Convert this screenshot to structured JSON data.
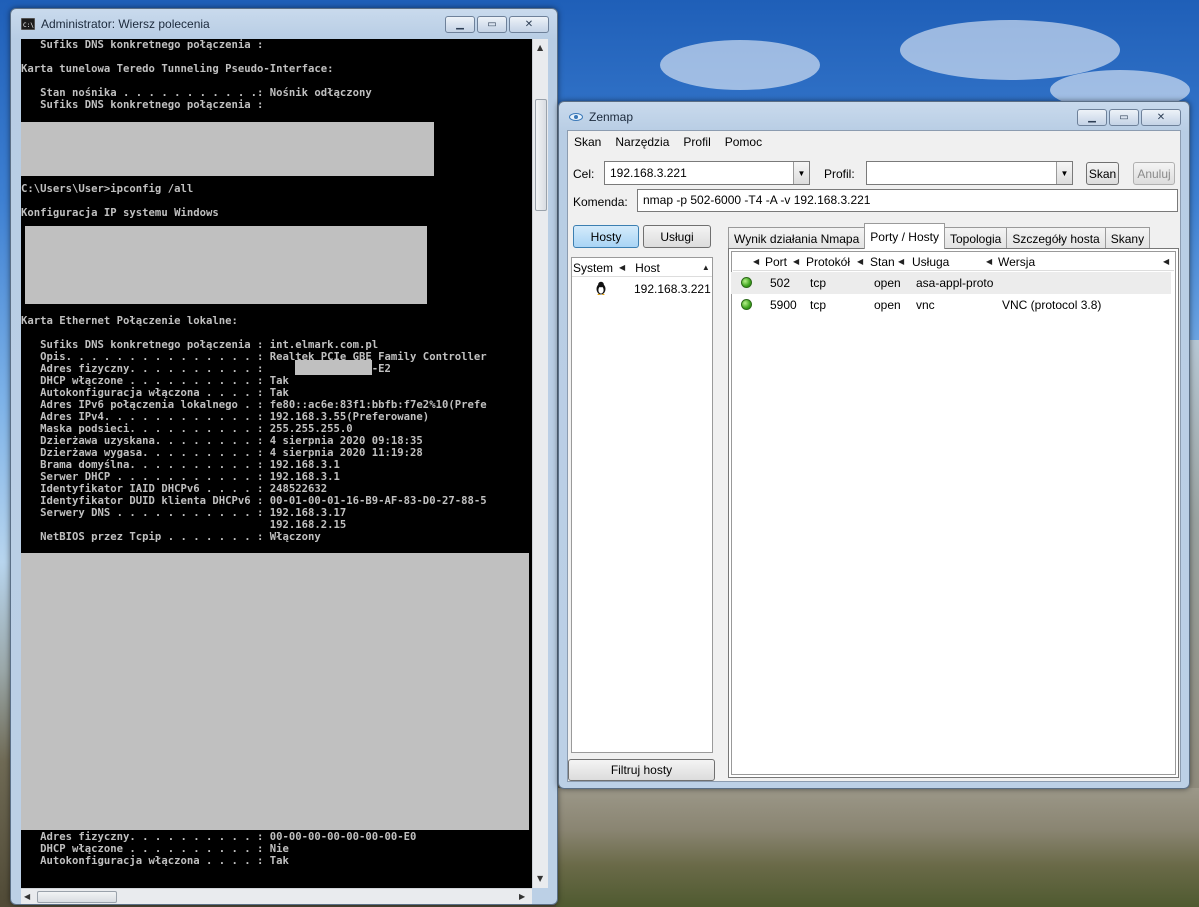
{
  "cmd_window": {
    "title": "Administrator: Wiersz polecenia",
    "icon": "console-icon",
    "lines": [
      "   Sufiks DNS konkretnego połączenia :",
      "",
      "Karta tunelowa Teredo Tunneling Pseudo-Interface:",
      "",
      "   Stan nośnika . . . . . . . . . . .: Nośnik odłączony",
      "   Sufiks DNS konkretnego połączenia :",
      "",
      "",
      "",
      "",
      "",
      "",
      "C:\\Users\\User>ipconfig /all",
      "",
      "Konfiguracja IP systemu Windows",
      "",
      "",
      "",
      "",
      "",
      "",
      "",
      "",
      "Karta Ethernet Połączenie lokalne:",
      "",
      "   Sufiks DNS konkretnego połączenia : int.elmark.com.pl",
      "   Opis. . . . . . . . . . . . . . . : Realtek PCIe GBE Family Controller",
      "   Adres fizyczny. . . . . . . . . . :              -6F-E2",
      "   DHCP włączone . . . . . . . . . . : Tak",
      "   Autokonfiguracja włączona . . . . : Tak",
      "   Adres IPv6 połączenia lokalnego . : fe80::ac6e:83f1:bbfb:f7e2%10(Prefe",
      "   Adres IPv4. . . . . . . . . . . . : 192.168.3.55(Preferowane)",
      "   Maska podsieci. . . . . . . . . . : 255.255.255.0",
      "   Dzierżawa uzyskana. . . . . . . . : 4 sierpnia 2020 09:18:35",
      "   Dzierżawa wygasa. . . . . . . . . : 4 sierpnia 2020 11:19:28",
      "   Brama domyślna. . . . . . . . . . : 192.168.3.1",
      "   Serwer DHCP . . . . . . . . . . . : 192.168.3.1",
      "   Identyfikator IAID DHCPv6 . . . . : 248522632",
      "   Identyfikator DUID klienta DHCPv6 : 00-01-00-01-16-B9-AF-83-D0-27-88-5",
      "   Serwery DNS . . . . . . . . . . . : 192.168.3.17",
      "                                       192.168.2.15",
      "   NetBIOS przez Tcpip . . . . . . . : Włączony"
    ],
    "bottom_lines": [
      "   Adres fizyczny. . . . . . . . . . : 00-00-00-00-00-00-00-E0",
      "   DHCP włączone . . . . . . . . . . : Nie",
      "   Autokonfiguracja włączona . . . . : Tak"
    ]
  },
  "zenmap": {
    "title": "Zenmap",
    "menu": [
      "Skan",
      "Narzędzia",
      "Profil",
      "Pomoc"
    ],
    "target_label": "Cel:",
    "target_value": "192.168.3.221",
    "profile_label": "Profil:",
    "profile_value": "",
    "scan_button": "Skan",
    "cancel_button": "Anuluj",
    "command_label": "Komenda:",
    "command_value": "nmap -p 502-6000 -T4 -A -v 192.168.3.221",
    "hosts_button": "Hosty",
    "services_button": "Usługi",
    "host_columns": [
      "System",
      "Host"
    ],
    "hosts": [
      {
        "os_icon": "linux-penguin-icon",
        "host": "192.168.3.221"
      }
    ],
    "filter_button": "Filtruj hosty",
    "tabs": [
      "Wynik działania Nmapa",
      "Porty / Hosty",
      "Topologia",
      "Szczegóły hosta",
      "Skany"
    ],
    "selected_tab": "Porty / Hosty",
    "port_columns": [
      "Port",
      "Protokół",
      "Stan",
      "Usługa",
      "Wersja"
    ],
    "ports": [
      {
        "port": "502",
        "protocol": "tcp",
        "state": "open",
        "service": "asa-appl-proto",
        "version": ""
      },
      {
        "port": "5900",
        "protocol": "tcp",
        "state": "open",
        "service": "vnc",
        "version": "VNC (protocol 3.8)"
      }
    ],
    "status_color": "#3ea41e"
  }
}
